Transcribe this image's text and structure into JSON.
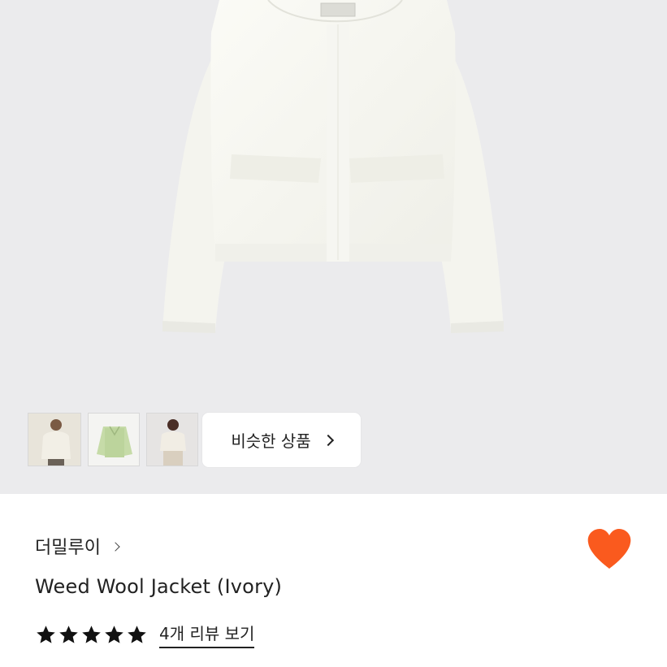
{
  "gallery": {
    "thumbnails": [
      {
        "name": "thumb-model-front"
      },
      {
        "name": "thumb-green-jacket"
      },
      {
        "name": "thumb-model-ivory"
      }
    ],
    "similar_button_label": "비슷한 상품"
  },
  "product": {
    "brand": "더밀루이",
    "title": "Weed Wool Jacket (Ivory)",
    "rating_stars": 5,
    "reviews_link": "4개 리뷰 보기",
    "favorite_icon": "heart-icon",
    "favorite_color": "#fa5a1e"
  },
  "colors": {
    "hero_bg": "#ebebed",
    "star": "#111111"
  }
}
